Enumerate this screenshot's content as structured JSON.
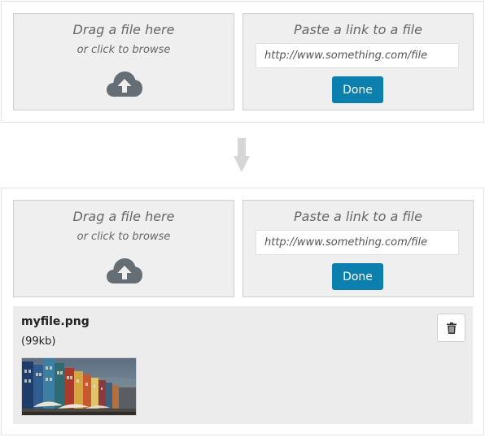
{
  "upload_panels": [
    {
      "drop_zone": {
        "title": "Drag a file here",
        "subtitle": "or click to browse",
        "icon": "cloud-upload-icon"
      },
      "link_zone": {
        "title": "Paste a link to a file",
        "url_value": "http://www.something.com/file",
        "done_label": "Done"
      }
    },
    {
      "drop_zone": {
        "title": "Drag a file here",
        "subtitle": "or click to browse",
        "icon": "cloud-upload-icon"
      },
      "link_zone": {
        "title": "Paste a link to a file",
        "url_value": "http://www.something.com/file",
        "done_label": "Done"
      }
    }
  ],
  "transition_icon": "arrow-down-icon",
  "uploaded_file": {
    "name": "myfile.png",
    "size": "(99kb)",
    "delete_icon": "trash-icon",
    "thumbnail": "colorful-harbor-houses-photo"
  },
  "colors": {
    "accent": "#0b7fad",
    "zone_bg": "#efefef",
    "icon": "#666e75",
    "file_row_bg": "#ececec"
  }
}
